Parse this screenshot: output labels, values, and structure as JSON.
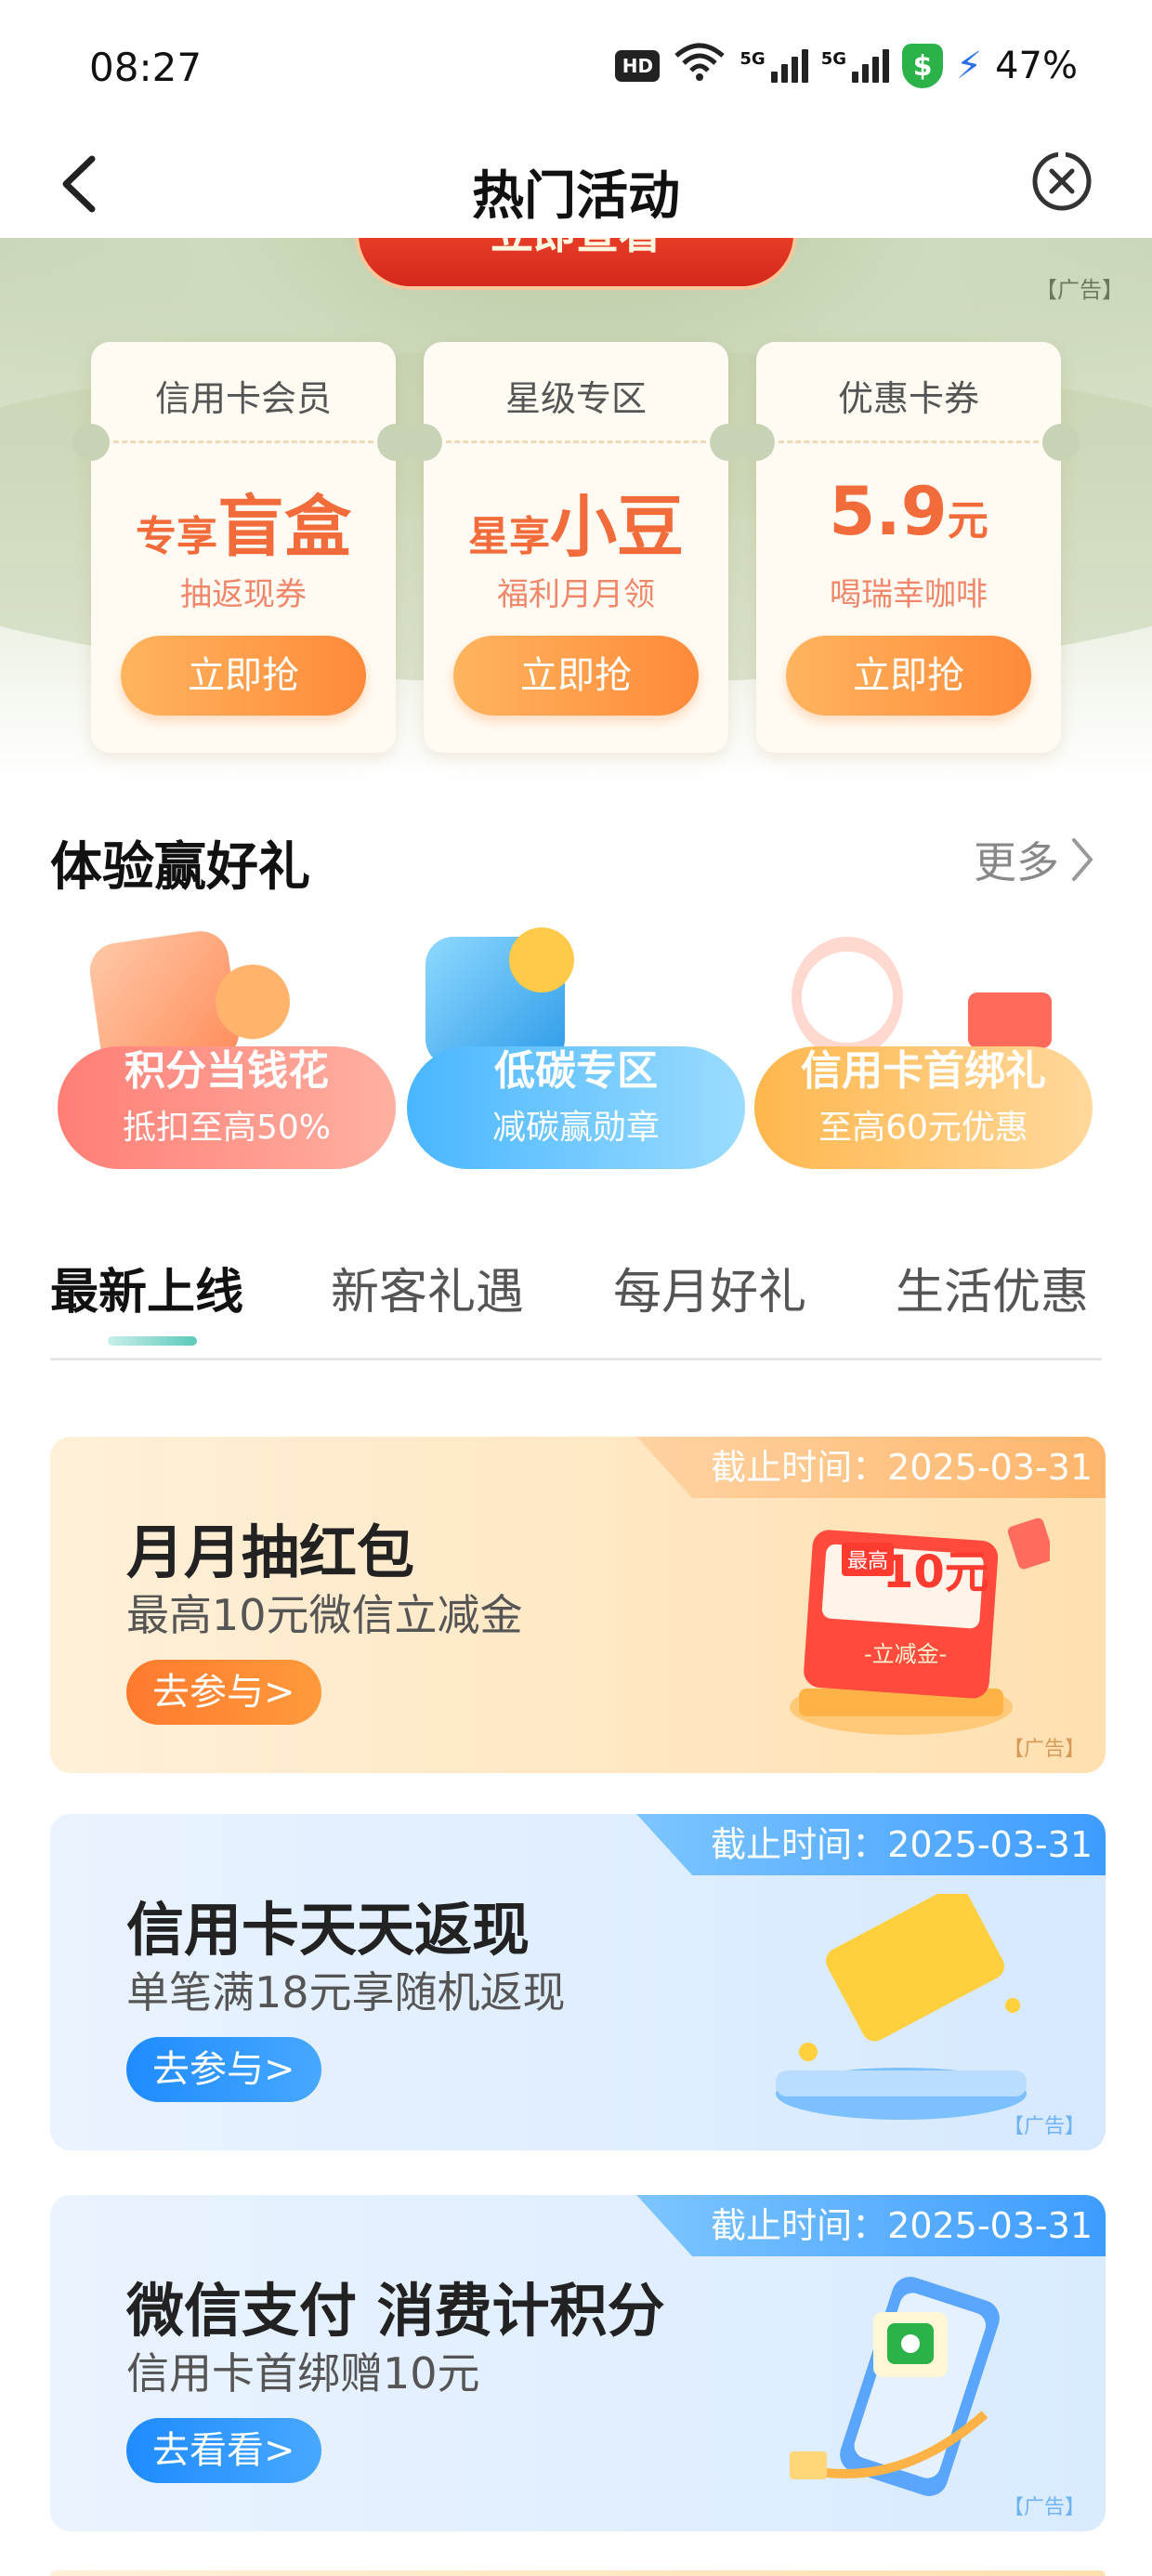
{
  "status": {
    "time": "08:27",
    "hd": "HD",
    "net1": "5G",
    "net2": "5G",
    "shield": "$",
    "battery": "47%"
  },
  "header": {
    "title": "热门活动"
  },
  "top_banner": {
    "button_text": "立即查看",
    "ad_label": "【广告】",
    "cards": [
      {
        "title": "信用卡会员",
        "small": "专享",
        "big": "盲盒",
        "sub": "抽返现券",
        "button": "立即抢"
      },
      {
        "title": "星级专区",
        "small": "星享",
        "big": "小豆",
        "sub": "福利月月领",
        "button": "立即抢"
      },
      {
        "title": "优惠卡券",
        "small": "元",
        "big": "5.9",
        "sub": "喝瑞幸咖啡",
        "button": "立即抢"
      }
    ]
  },
  "experience": {
    "title": "体验赢好礼",
    "more": "更多",
    "items": [
      {
        "title": "积分当钱花",
        "subtitle": "抵扣至高50%"
      },
      {
        "title": "低碳专区",
        "subtitle": "减碳赢勋章"
      },
      {
        "title": "信用卡首绑礼",
        "subtitle": "至高60元优惠"
      }
    ]
  },
  "tabs": [
    "最新上线",
    "新客礼遇",
    "每月好礼",
    "生活优惠"
  ],
  "activities": [
    {
      "deadline": "截止时间：2025-03-31",
      "title": "月月抽红包",
      "subtitle": "最高10元微信立减金",
      "button": "去参与>",
      "ad": "【广告】",
      "art_amount": "10元",
      "art_label": "-立减金-",
      "art_tag": "最高"
    },
    {
      "deadline": "截止时间：2025-03-31",
      "title": "信用卡天天返现",
      "subtitle": "单笔满18元享随机返现",
      "button": "去参与>",
      "ad": "【广告】"
    },
    {
      "deadline": "截止时间：2025-03-31",
      "title": "微信支付 消费计积分",
      "subtitle": "信用卡首绑赠10元",
      "button": "去看看>",
      "ad": "【广告】"
    }
  ]
}
